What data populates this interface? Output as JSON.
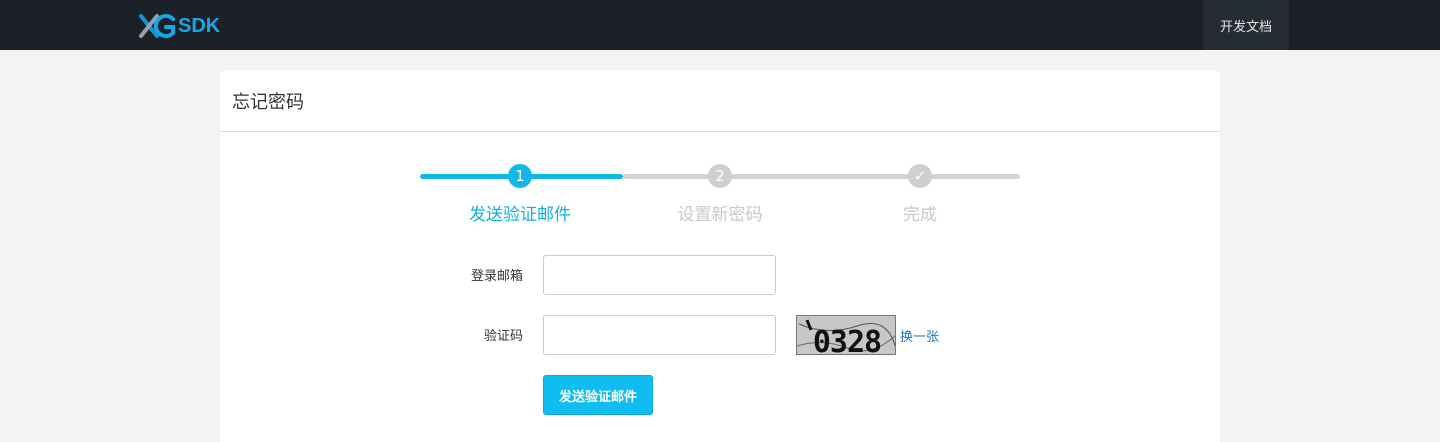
{
  "header": {
    "logo_text": "SDK",
    "nav_docs_label": "开发文档"
  },
  "card": {
    "title": "忘记密码"
  },
  "steps": [
    {
      "number": "1",
      "label": "发送验证邮件",
      "state": "active"
    },
    {
      "number": "2",
      "label": "设置新密码",
      "state": "todo"
    },
    {
      "number": "✓",
      "label": "完成",
      "state": "todo"
    }
  ],
  "form": {
    "email_label": "登录邮箱",
    "email_value": "",
    "captcha_label": "验证码",
    "captcha_value": "",
    "captcha_text": "0328",
    "refresh_label": "换一张",
    "submit_label": "发送验证邮件"
  },
  "colors": {
    "topbar": "#1b2127",
    "accent": "#10b7ea",
    "inactive": "#d3d3d3",
    "link": "#1a73c4"
  }
}
